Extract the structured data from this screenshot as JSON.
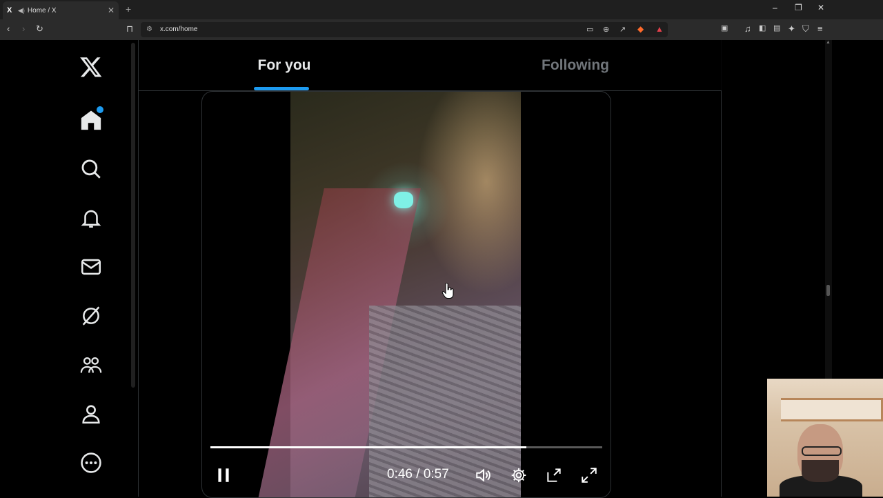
{
  "browser": {
    "tab_title": "Home / X",
    "favicon": "X",
    "url": "x.com/home"
  },
  "sidebar": {
    "items": [
      {
        "name": "x-logo-icon"
      },
      {
        "name": "home-icon",
        "notification_dot": true
      },
      {
        "name": "search-icon"
      },
      {
        "name": "notifications-icon"
      },
      {
        "name": "messages-icon"
      },
      {
        "name": "grok-icon"
      },
      {
        "name": "communities-icon"
      },
      {
        "name": "profile-icon"
      },
      {
        "name": "more-icon"
      }
    ]
  },
  "timeline": {
    "tabs": [
      {
        "label": "For you",
        "active": true
      },
      {
        "label": "Following",
        "active": false
      }
    ]
  },
  "video": {
    "current_time": "0:46",
    "duration": "0:57",
    "time_display": "0:46 / 0:57",
    "progress": 0.807
  },
  "colors": {
    "accent": "#1d9bf0",
    "background": "#000000",
    "inactive_text": "#71767b"
  }
}
